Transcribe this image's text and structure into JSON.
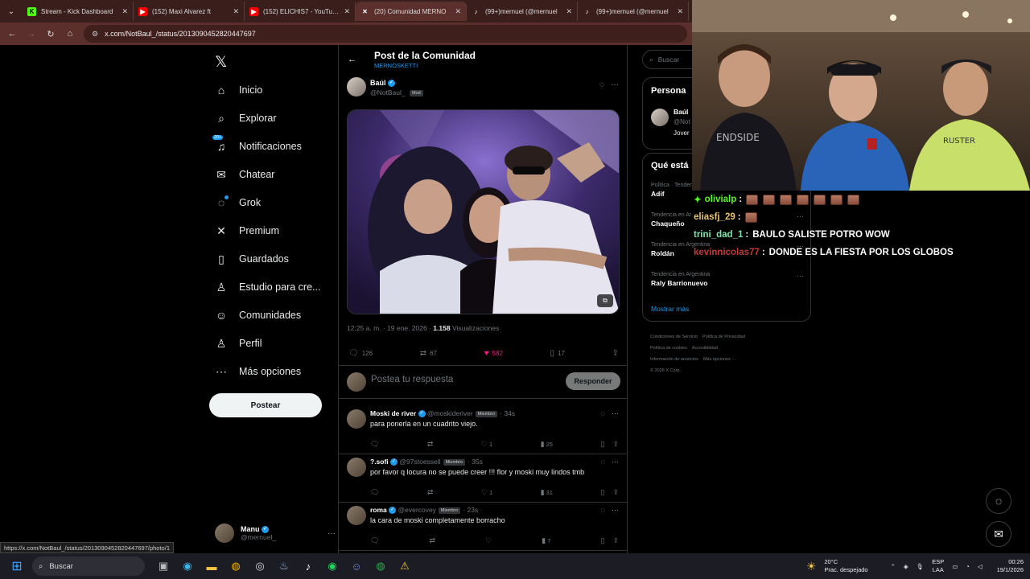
{
  "browser": {
    "tabs": [
      {
        "title": "Stream - Kick Dashboard",
        "icon": "kick-icon",
        "color": "#53fc18"
      },
      {
        "title": "(152) Maxi Alvarez ft",
        "icon": "youtube-icon",
        "color": "#ff0000"
      },
      {
        "title": "(152) ELICHIS7 - YouTube",
        "icon": "youtube-icon",
        "color": "#ff0000"
      },
      {
        "title": "(20) Comunidad MERNO",
        "icon": "x-icon",
        "color": "#ffffff"
      },
      {
        "title": "(99+)mernuel (@mernuel",
        "icon": "tiktok-icon",
        "color": "#ffffff"
      },
      {
        "title": "(99+)mernuel (@mernuel",
        "icon": "tiktok-icon",
        "color": "#ffffff"
      }
    ],
    "url": "x.com/NotBaul_/status/2013090452820447697",
    "status_url": "https://x.com/NotBaul_/status/2013090452820447697/photo/1"
  },
  "sidebar": {
    "items": [
      {
        "label": "Inicio",
        "icon": "home-icon",
        "glyph": "⌂"
      },
      {
        "label": "Explorar",
        "icon": "search-icon",
        "glyph": "⌕"
      },
      {
        "label": "Notificaciones",
        "icon": "bell-icon",
        "glyph": "♫",
        "badge": "20+"
      },
      {
        "label": "Chatear",
        "icon": "mail-icon",
        "glyph": "✉"
      },
      {
        "label": "Grok",
        "icon": "grok-icon",
        "glyph": "◌"
      },
      {
        "label": "Premium",
        "icon": "x-premium-icon",
        "glyph": "✕"
      },
      {
        "label": "Guardados",
        "icon": "bookmark-icon",
        "glyph": "▯"
      },
      {
        "label": "Estudio para cre...",
        "icon": "studio-icon",
        "glyph": "♙"
      },
      {
        "label": "Comunidades",
        "icon": "communities-icon",
        "glyph": "☺"
      },
      {
        "label": "Perfil",
        "icon": "profile-icon",
        "glyph": "♙"
      },
      {
        "label": "Más opciones",
        "icon": "more-options-icon",
        "glyph": "⋯"
      }
    ],
    "post_button": "Postear",
    "account": {
      "name": "Manu",
      "handle": "@mernuel_"
    }
  },
  "main": {
    "header": {
      "title": "Post de la Comunidad",
      "subtitle": "MERNOSKETTI"
    },
    "post": {
      "author": "Baúl",
      "handle": "@NotBaul_",
      "role": "Mod",
      "time": "12:25 a. m. · 19 ene. 2026 ·",
      "views": "1.158",
      "views_label": "Visualizaciones",
      "stats": {
        "replies": "126",
        "reposts": "67",
        "likes": "582",
        "bookmarks": "17"
      }
    },
    "reply_placeholder": "Postea tu respuesta",
    "reply_button": "Responder",
    "replies": [
      {
        "name": "Moski de river",
        "handle": "@moskideriver",
        "role": "Miembro",
        "time": "34s",
        "text": "para ponerla en un cuadrito viejo.",
        "likes": "1",
        "views": "25"
      },
      {
        "name": "?.sofi",
        "handle": "@97stoessell",
        "role": "Miembro",
        "time": "35s",
        "text": "por favor q locura no se puede creer !!! flor y moski muy lindos tmb",
        "likes": "1",
        "views": "31"
      },
      {
        "name": "roma",
        "handle": "@evercovey",
        "role": "Miembro",
        "time": "23s",
        "text": "la cara de moski completamente borracho",
        "likes": "",
        "views": "7"
      }
    ]
  },
  "right": {
    "search_placeholder": "Buscar",
    "people": {
      "title": "Persona",
      "name": "Baúl",
      "handle": "@Not",
      "bio": "Jover"
    },
    "trends_title": "Qué está",
    "trends": [
      {
        "category": "Política · Tendencia",
        "name": "Adif"
      },
      {
        "category": "Tendencia en Ar",
        "name": "Chaqueño"
      },
      {
        "category": "Tendencia en Argentina",
        "name": "Roldán"
      },
      {
        "category": "Tendencia en Argentina",
        "name": "Raly Barrionuevo"
      }
    ],
    "show_more": "Mostrar más",
    "footer": [
      "Condiciones de Servicio",
      "Política de Privacidad",
      "Política de cookies",
      "Accesibilidad",
      "Información de anuncios",
      "Más opciones ···",
      "© 2026 X Corp."
    ]
  },
  "chat": [
    {
      "user": "olivialp",
      "color": "#53fc18",
      "message": "",
      "emotes": 7,
      "prefix": "✦"
    },
    {
      "user": "eliasfj_29",
      "color": "#e8c170",
      "message": "",
      "emotes": 1
    },
    {
      "user": "trini_dad_1",
      "color": "#7fe5a8",
      "message": "BAULO SALISTE POTRO WOW",
      "emotes": 0
    },
    {
      "user": "kevinnicolas77",
      "color": "#c43a3a",
      "message": "DONDE ES LA FIESTA POR LOS GLOBOS",
      "emotes": 0
    }
  ],
  "taskbar": {
    "search": "Buscar",
    "weather": {
      "temp": "20°C",
      "desc": "Prac. despejado"
    },
    "lang": {
      "l1": "ESP",
      "l2": "LAA"
    },
    "clock": {
      "time": "00:26",
      "date": "19/1/2026"
    }
  },
  "colors": {
    "accent": "#1d9bf0",
    "like": "#f91880",
    "background": "#000000"
  }
}
